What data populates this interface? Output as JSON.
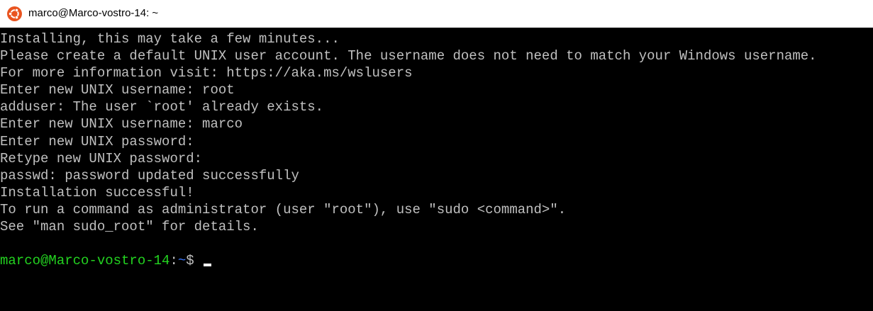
{
  "window": {
    "title": "marco@Marco-vostro-14: ~",
    "icon": "ubuntu-icon",
    "accent_color": "#e95420"
  },
  "terminal": {
    "lines": [
      "Installing, this may take a few minutes...",
      "Please create a default UNIX user account. The username does not need to match your Windows username.",
      "For more information visit: https://aka.ms/wslusers",
      "Enter new UNIX username: root",
      "adduser: The user `root' already exists.",
      "Enter new UNIX username: marco",
      "Enter new UNIX password:",
      "Retype new UNIX password:",
      "passwd: password updated successfully",
      "Installation successful!",
      "To run a command as administrator (user \"root\"), use \"sudo <command>\".",
      "See \"man sudo_root\" for details."
    ],
    "prompt": {
      "user_host": "marco@Marco-vostro-14",
      "separator": ":",
      "path": "~",
      "symbol": "$ "
    },
    "colors": {
      "text": "#c0c0c0",
      "prompt_user_host": "#23d320",
      "prompt_path": "#3b78ff",
      "background": "#000000"
    }
  }
}
